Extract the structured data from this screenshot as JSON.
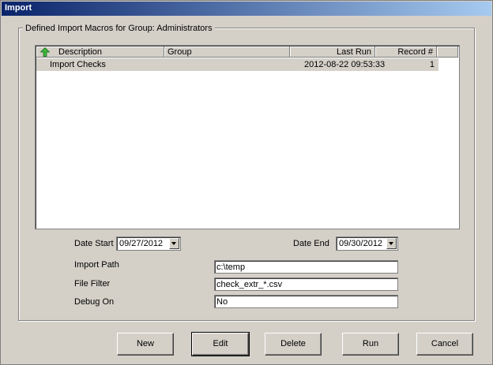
{
  "window": {
    "title": "Import"
  },
  "group": {
    "label": "Defined Import Macros for Group: Administrators"
  },
  "list": {
    "sort_icon": "green-up-arrow-icon",
    "columns": {
      "description": "Description",
      "group": "Group",
      "last_run": "Last Run",
      "record": "Record #"
    },
    "rows": [
      {
        "description": "Import Checks",
        "group": "",
        "last_run": "2012-08-22 09:53:33",
        "record": "1"
      }
    ]
  },
  "form": {
    "date_start_label": "Date Start",
    "date_start": "09/27/2012",
    "date_end_label": "Date End",
    "date_end": "09/30/2012",
    "import_path_label": "Import Path",
    "import_path": "c:\\temp",
    "file_filter_label": "File Filter",
    "file_filter": "check_extr_*.csv",
    "debug_on_label": "Debug On",
    "debug_on": "No"
  },
  "buttons": {
    "new": "New",
    "edit": "Edit",
    "delete": "Delete",
    "run": "Run",
    "cancel": "Cancel"
  }
}
